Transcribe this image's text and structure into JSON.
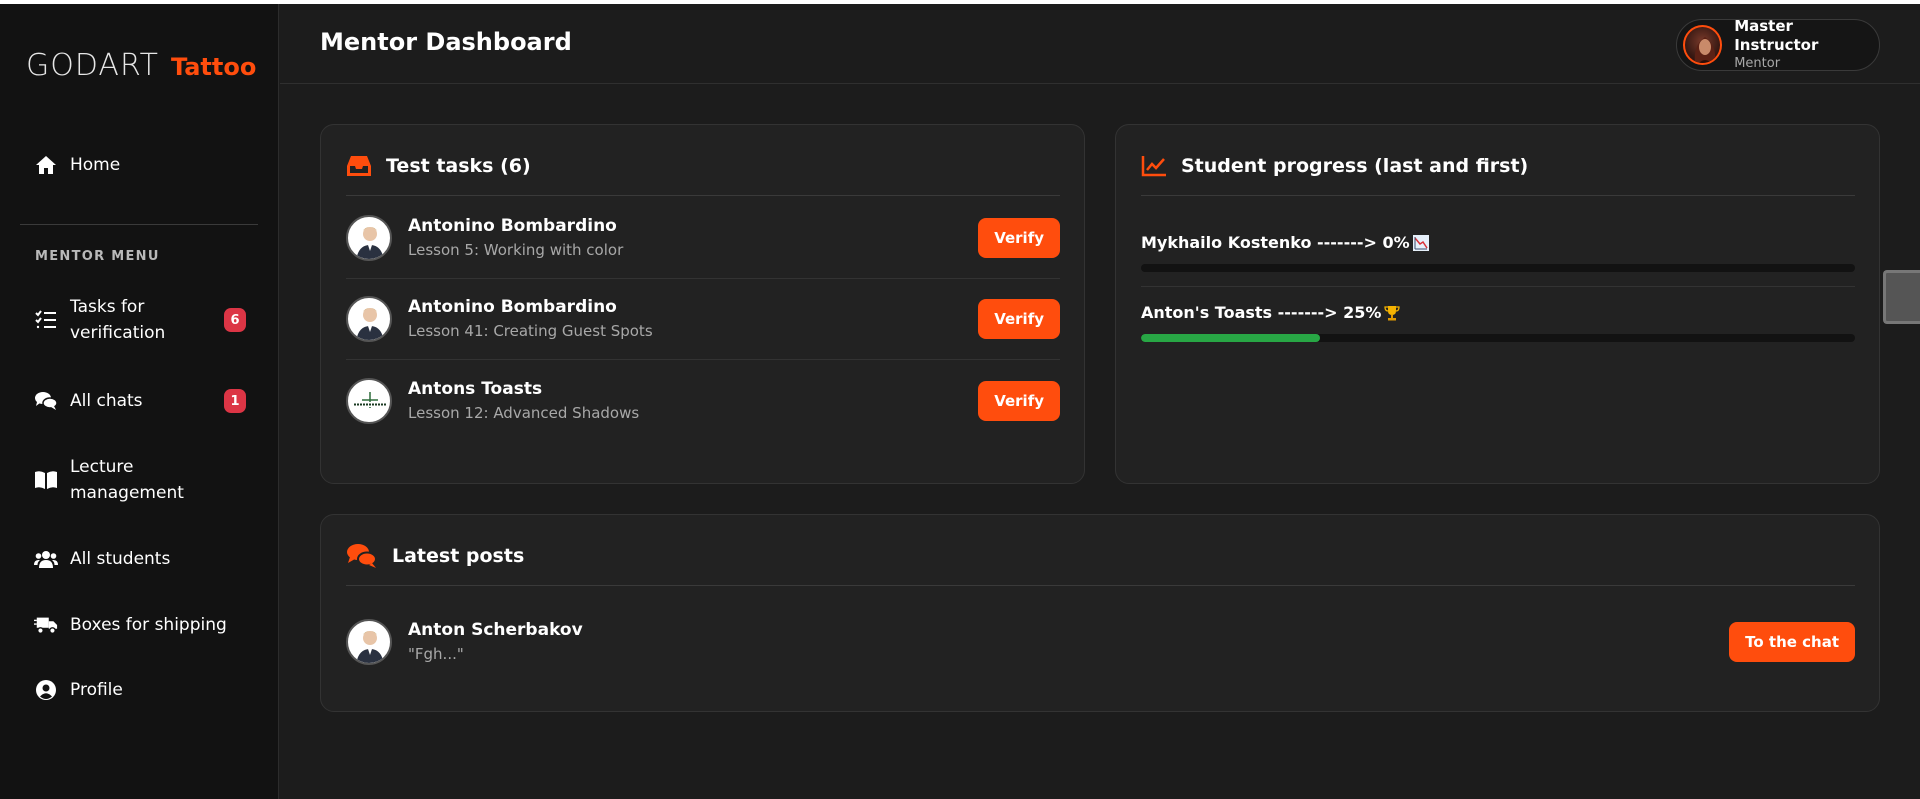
{
  "brand": {
    "name_part1": "GODART",
    "name_part2": "Tattoo",
    "accent": "#ff4d0d"
  },
  "sidebar": {
    "home_label": "Home",
    "section_title": "MENTOR MENU",
    "items": [
      {
        "label": "Tasks for verification",
        "badge": "6",
        "icon": "tasks-icon"
      },
      {
        "label": "All chats",
        "badge": "1",
        "icon": "chats-icon"
      },
      {
        "label": "Lecture management",
        "icon": "book-icon"
      },
      {
        "label": "All students",
        "icon": "users-icon"
      },
      {
        "label": "Boxes for shipping",
        "icon": "truck-icon"
      },
      {
        "label": "Profile",
        "icon": "user-circle-icon"
      }
    ]
  },
  "header": {
    "title": "Mentor Dashboard",
    "user": {
      "name": "Master Instructor",
      "role": "Mentor"
    }
  },
  "test_tasks": {
    "title": "Test tasks (6)",
    "rows": [
      {
        "name": "Antonino Bombardino",
        "lesson": "Lesson 5: Working with color",
        "button": "Verify"
      },
      {
        "name": "Antonino Bombardino",
        "lesson": "Lesson 41: Creating Guest Spots",
        "button": "Verify"
      },
      {
        "name": "Antons Toasts",
        "lesson": "Lesson 12: Advanced Shadows",
        "button": "Verify"
      }
    ]
  },
  "student_progress": {
    "title": "Student progress (last and first)",
    "rows": [
      {
        "label": "Mykhailo Kostenko -------> 0%",
        "icon": "chart-down-icon",
        "percent": 0
      },
      {
        "label": "Anton's Toasts -------> 25%",
        "icon": "trophy-icon",
        "percent": 25
      }
    ],
    "fill_color": "#28a745"
  },
  "latest_posts": {
    "title": "Latest posts",
    "rows": [
      {
        "name": "Anton Scherbakov",
        "text": "\"Fgh...\"",
        "button": "To the chat"
      }
    ]
  },
  "colors": {
    "badge": "#dc3545",
    "background": "#1c1c1c",
    "sidebar": "#121212",
    "card": "#222222"
  }
}
